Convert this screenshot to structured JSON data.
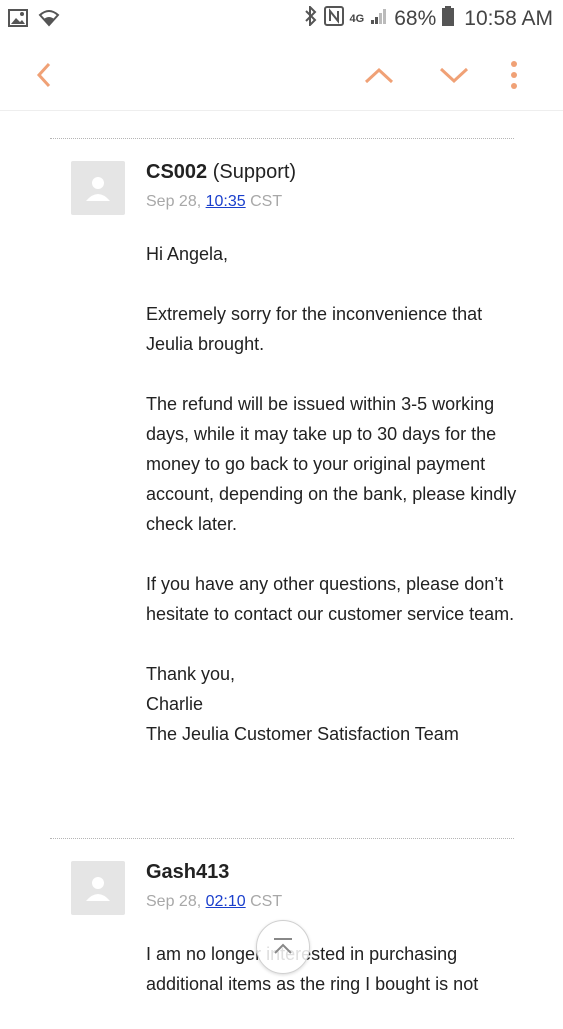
{
  "status": {
    "battery_pct": "68%",
    "time": "10:58 AM",
    "network": "4G"
  },
  "colors": {
    "accent": "#F0A176",
    "link": "#1A3FCC"
  },
  "toolbar": {
    "back_icon": "chevron-left-icon",
    "prev_icon": "chevron-up-icon",
    "next_icon": "chevron-down-icon",
    "more_icon": "more-vertical-icon"
  },
  "messages": [
    {
      "sender_name": "CS002",
      "sender_role": "(Support)",
      "date": "Sep 28,",
      "time": "10:35",
      "tz": "CST",
      "paragraphs": [
        "Hi Angela,",
        "Extremely sorry for the inconvenience that Jeulia brought.",
        "The refund will be issued within 3-5 working days, while it may take up to 30 days for the money to go back to your original payment account, depending on the bank, please kindly check later.",
        "If you have any other questions, please don’t hesitate to contact our customer service team."
      ],
      "signoff": [
        "Thank you,",
        "Charlie",
        "The Jeulia Customer Satisfaction Team"
      ]
    },
    {
      "sender_name": "Gash413",
      "sender_role": "",
      "date": "Sep 28,",
      "time": "02:10",
      "tz": "CST",
      "paragraphs": [
        "I am no longer interested in purchasing additional items as the ring I bought is not"
      ]
    }
  ]
}
